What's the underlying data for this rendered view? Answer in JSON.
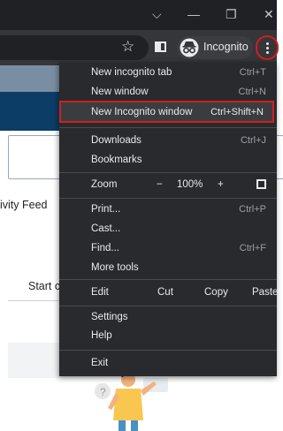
{
  "browser": {
    "window_controls": {
      "chevron": "⌵",
      "minimize": "—",
      "restore": "❐",
      "close": "✕"
    },
    "profile_label": "Incognito",
    "icons": [
      "star-icon",
      "side-panel-icon",
      "incognito-icon",
      "kebab-menu-icon"
    ],
    "highlight_color": "#d31e1e"
  },
  "page": {
    "activity_text": "ivity Feed",
    "start_text": "Start c"
  },
  "menu": {
    "new_tab": {
      "label": "New incognito tab",
      "shortcut": "Ctrl+T"
    },
    "new_window": {
      "label": "New window",
      "shortcut": "Ctrl+N"
    },
    "new_incognito": {
      "label": "New Incognito window",
      "shortcut": "Ctrl+Shift+N"
    },
    "downloads": {
      "label": "Downloads",
      "shortcut": "Ctrl+J"
    },
    "bookmarks": {
      "label": "Bookmarks"
    },
    "zoom": {
      "label": "Zoom",
      "minus": "−",
      "value": "100%",
      "plus": "+"
    },
    "print": {
      "label": "Print...",
      "shortcut": "Ctrl+P"
    },
    "cast": {
      "label": "Cast..."
    },
    "find": {
      "label": "Find...",
      "shortcut": "Ctrl+F"
    },
    "more_tools": {
      "label": "More tools"
    },
    "edit": {
      "label": "Edit",
      "cut": "Cut",
      "copy": "Copy",
      "paste": "Paste"
    },
    "settings": {
      "label": "Settings"
    },
    "help": {
      "label": "Help"
    },
    "exit": {
      "label": "Exit"
    }
  }
}
